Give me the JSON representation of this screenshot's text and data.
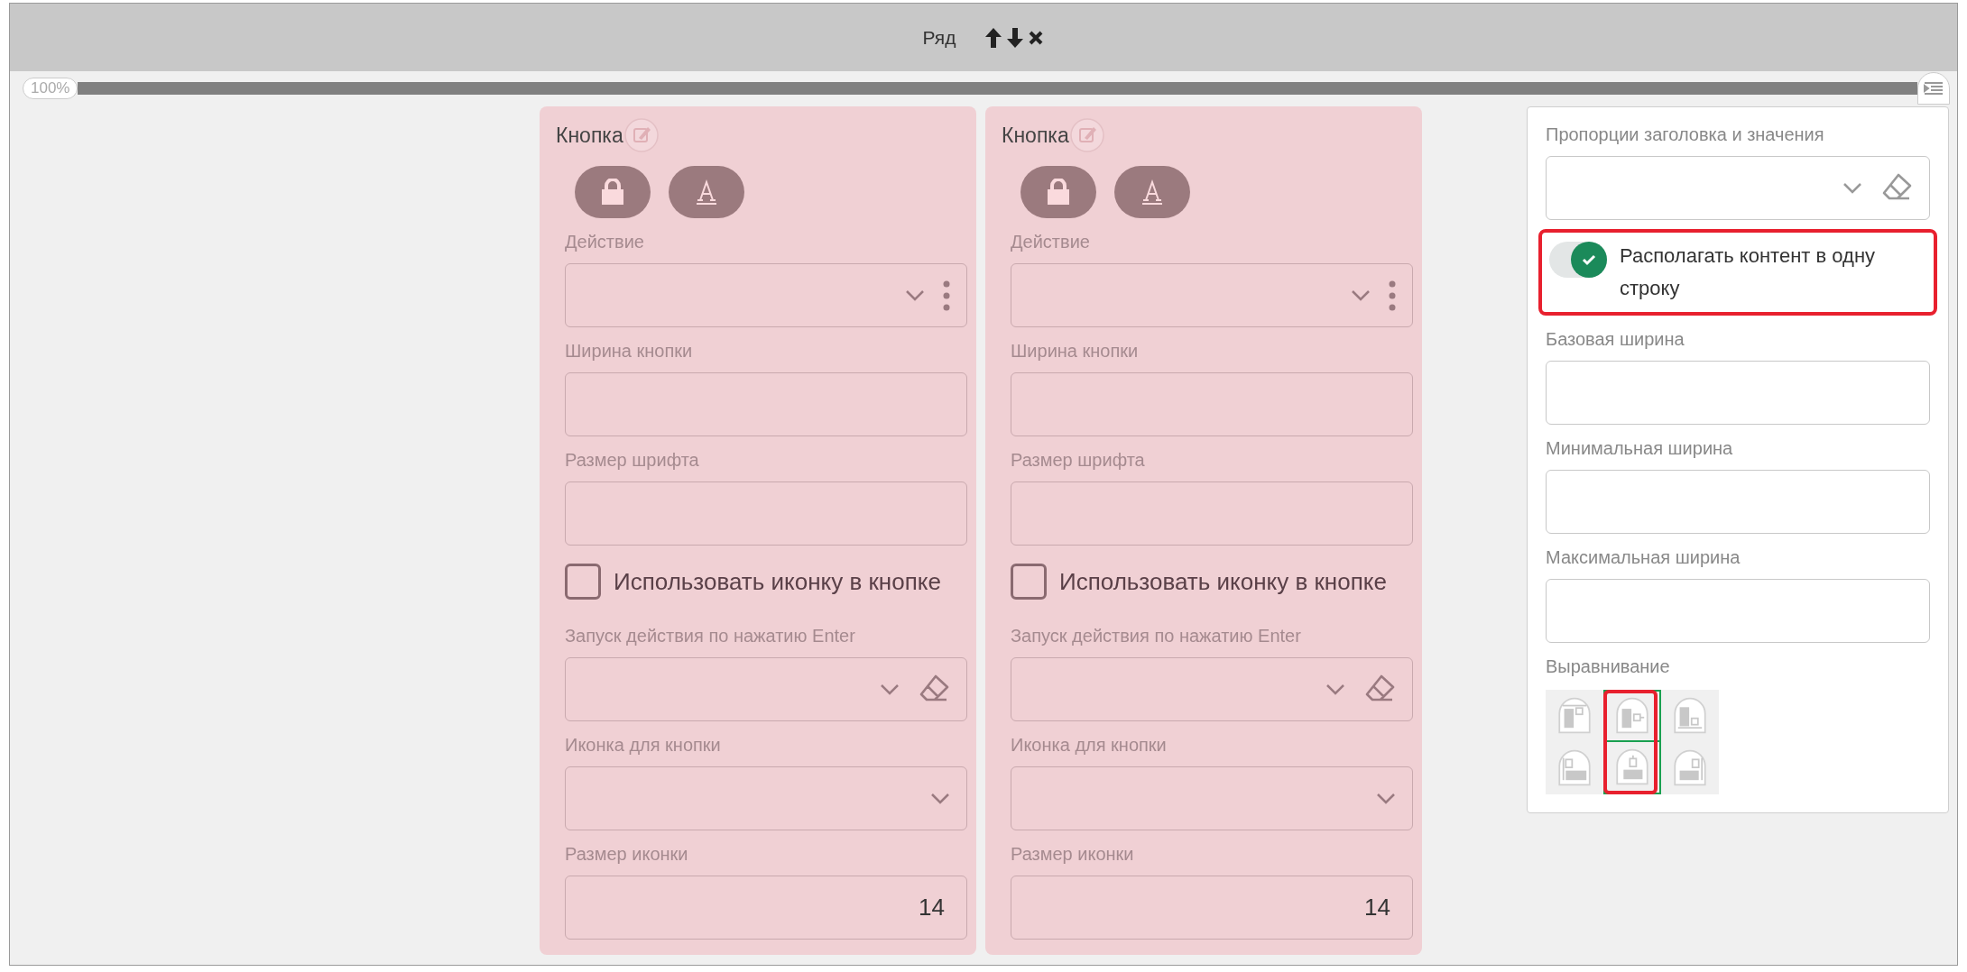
{
  "header": {
    "title": "Ряд"
  },
  "scale": {
    "label": "100%",
    "level": 1
  },
  "cards": [
    {
      "title": "Кнопка",
      "fields": [
        {
          "kind": "select-menu",
          "label": "Действие"
        },
        {
          "kind": "text",
          "label": "Ширина кнопки"
        },
        {
          "kind": "text",
          "label": "Размер шрифта"
        },
        {
          "kind": "checkbox",
          "label": "Использовать иконку в кнопке",
          "checked": false
        },
        {
          "kind": "select-clear",
          "label": "Запуск действия по нажатию Enter"
        },
        {
          "kind": "select",
          "label": "Иконка для кнопки"
        },
        {
          "kind": "text",
          "label": "Размер иконки",
          "value": "14"
        }
      ]
    },
    {
      "title": "Кнопка",
      "fields": [
        {
          "kind": "select-menu",
          "label": "Действие"
        },
        {
          "kind": "text",
          "label": "Ширина кнопки"
        },
        {
          "kind": "text",
          "label": "Размер шрифта"
        },
        {
          "kind": "checkbox",
          "label": "Использовать иконку в кнопке",
          "checked": false
        },
        {
          "kind": "select-clear",
          "label": "Запуск действия по нажатию Enter"
        },
        {
          "kind": "select",
          "label": "Иконка для кнопки"
        },
        {
          "kind": "text",
          "label": "Размер иконки",
          "value": "14"
        }
      ]
    }
  ],
  "panel": {
    "fields": [
      {
        "kind": "select-clear",
        "label": "Пропорции заголовка и значения"
      },
      {
        "kind": "toggle",
        "label": "Располагать контент в одну строку",
        "on": true,
        "highlighted": true
      },
      {
        "kind": "text",
        "label": "Базовая ширина"
      },
      {
        "kind": "text",
        "label": "Минимальная ширина"
      },
      {
        "kind": "text",
        "label": "Максимальная ширина"
      },
      {
        "kind": "align",
        "label": "Выравнивание",
        "highlighted": true,
        "options": [
          {
            "selected": false
          },
          {
            "selected": true
          },
          {
            "selected": false
          },
          {
            "selected": false
          },
          {
            "selected": true
          },
          {
            "selected": false
          }
        ]
      }
    ]
  }
}
